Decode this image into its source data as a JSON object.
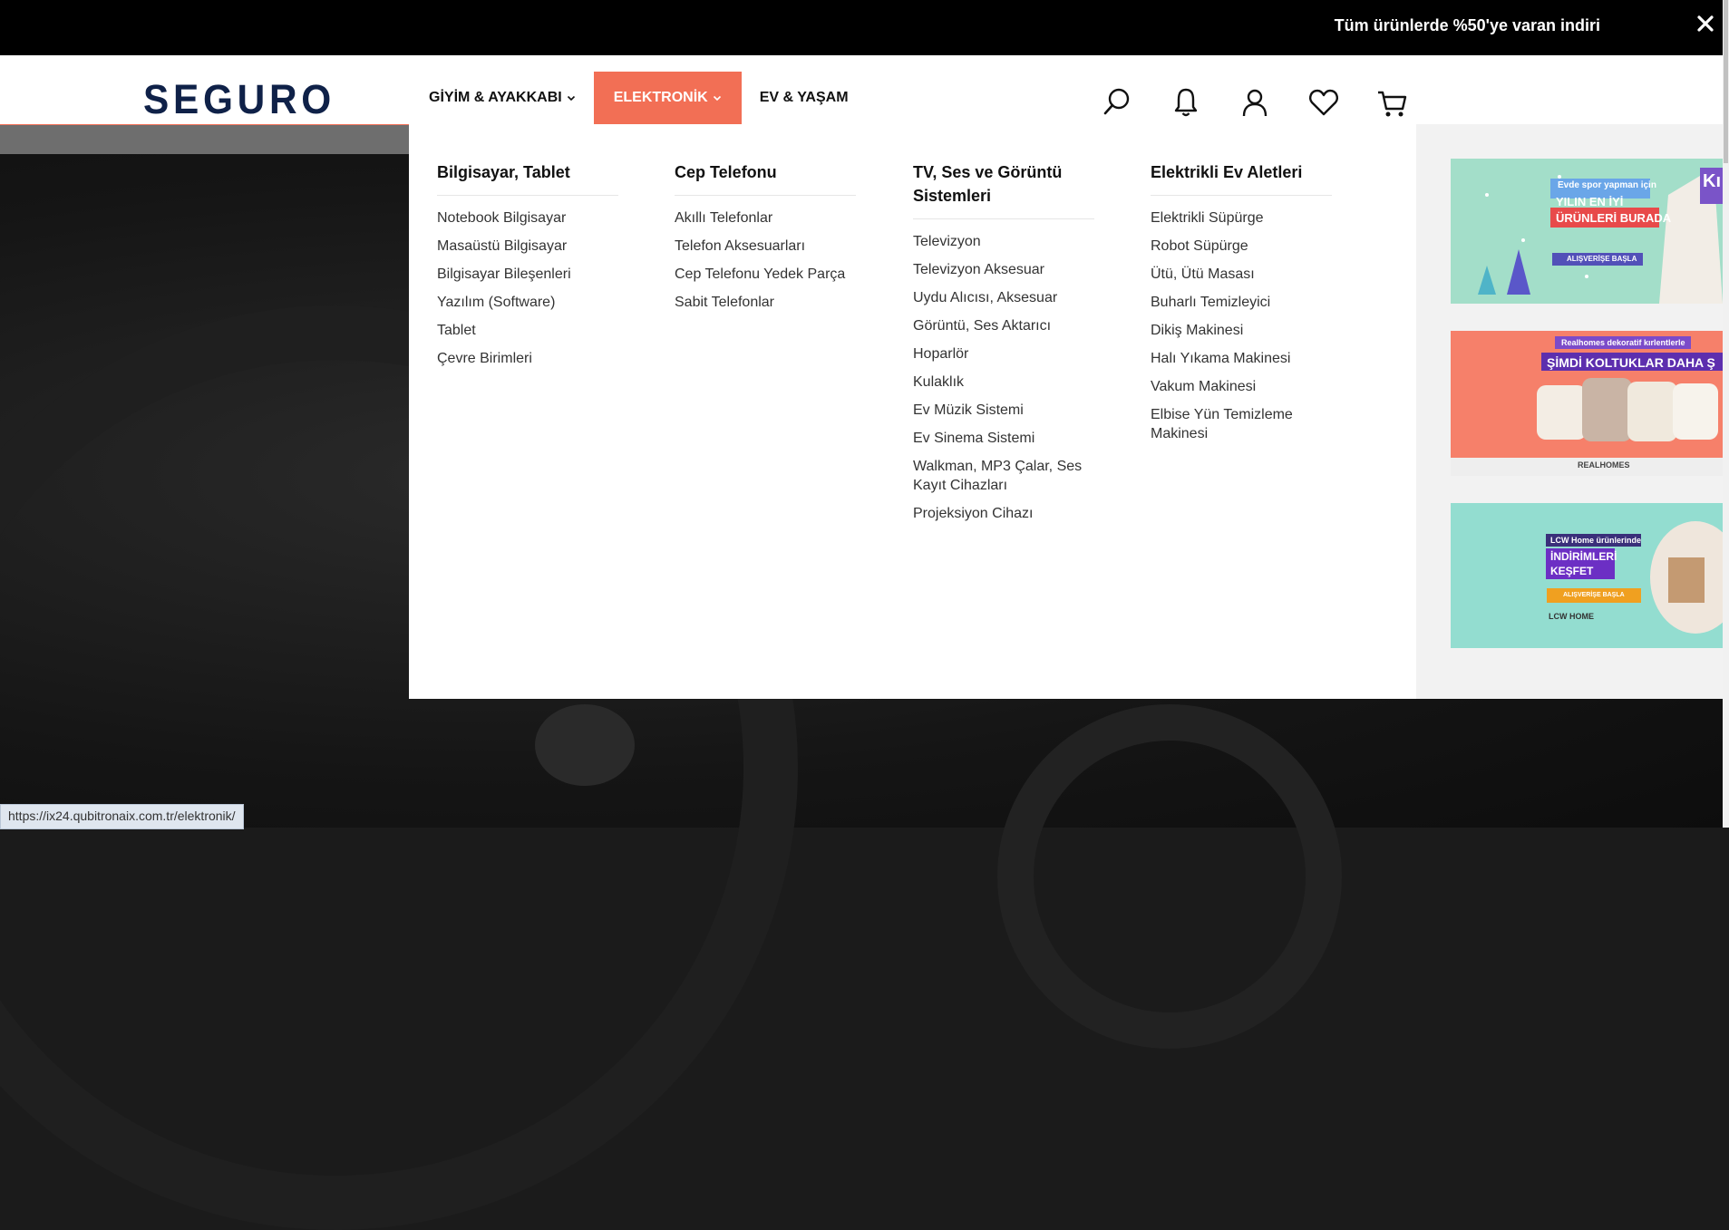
{
  "announcement": {
    "text": "Tüm ürünlerde %50'ye varan indiri"
  },
  "header": {
    "logo": "SEGURO",
    "nav": [
      {
        "label": "GİYİM & AYAKKABI",
        "dropdown": true,
        "active": false
      },
      {
        "label": "ELEKTRONİK",
        "dropdown": true,
        "active": true
      },
      {
        "label": "EV & YAŞAM",
        "dropdown": false,
        "active": false
      }
    ],
    "icons": [
      "search-icon",
      "bell-icon",
      "user-icon",
      "heart-icon",
      "cart-icon"
    ]
  },
  "menu": {
    "columns": [
      {
        "title": "Bilgisayar, Tablet",
        "items": [
          "Notebook Bilgisayar",
          "Masaüstü Bilgisayar",
          "Bilgisayar Bileşenleri",
          "Yazılım (Software)",
          "Tablet",
          "Çevre Birimleri"
        ]
      },
      {
        "title": "Cep Telefonu",
        "items": [
          "Akıllı Telefonlar",
          "Telefon Aksesuarları",
          "Cep Telefonu Yedek Parça",
          "Sabit Telefonlar"
        ]
      },
      {
        "title": "TV, Ses ve Görüntü Sistemleri",
        "items": [
          "Televizyon",
          "Televizyon Aksesuar",
          "Uydu Alıcısı, Aksesuar",
          "Görüntü, Ses Aktarıcı",
          "Hoparlör",
          "Kulaklık",
          "Ev Müzik Sistemi",
          "Ev Sinema Sistemi",
          "Walkman, MP3 Çalar, Ses Kayıt Cihazları",
          "Projeksiyon Cihazı"
        ]
      },
      {
        "title": "Elektrikli Ev Aletleri",
        "items": [
          "Elektrikli Süpürge",
          "Robot Süpürge",
          "Ütü, Ütü Masası",
          "Buharlı Temizleyici",
          "Dikiş Makinesi",
          "Halı Yıkama Makinesi",
          "Vakum Makinesi",
          "Elbise Yün Temizleme Makinesi"
        ]
      }
    ],
    "banners": [
      {
        "line1": "Evde spor yapman için",
        "line2": "YILIN EN İYİ",
        "line3": "ÜRÜNLERİ BURADA",
        "cta": "ALIŞVERİŞE BAŞLA",
        "corner": "Kı"
      },
      {
        "line1": "Realhomes dekoratif kırlentlerle",
        "line2": "ŞİMDİ KOLTUKLAR DAHA Ş",
        "brand": "REALHOMES"
      },
      {
        "line1": "LCW Home ürünlerinde",
        "line2": "İNDİRİMLERİ",
        "line3": "KEŞFET",
        "cta": "ALIŞVERİŞE BAŞLA",
        "brand": "LCW HOME"
      }
    ]
  },
  "status_url": "https://ix24.qubitronaix.com.tr/elektronik/",
  "colors": {
    "accent": "#f26f55",
    "logo": "#0f2148",
    "topbar": "#000000"
  }
}
